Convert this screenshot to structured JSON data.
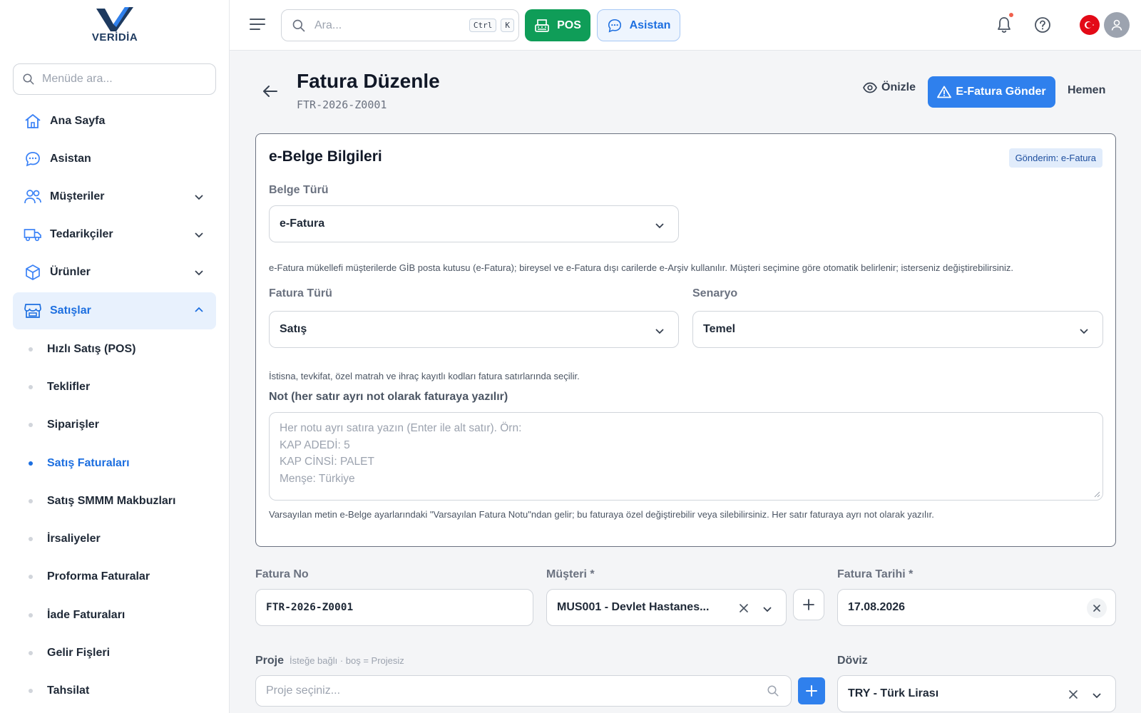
{
  "brand": {
    "logo_text": "VERİDİA"
  },
  "sidebar": {
    "search_placeholder": "Menüde ara...",
    "items": [
      {
        "label": "Ana Sayfa",
        "icon": "home-icon"
      },
      {
        "label": "Asistan",
        "icon": "chat-icon"
      },
      {
        "label": "Müşteriler",
        "icon": "users-icon",
        "expandable": true
      },
      {
        "label": "Tedarikçiler",
        "icon": "truck-icon",
        "expandable": true
      },
      {
        "label": "Ürünler",
        "icon": "box-icon",
        "expandable": true
      },
      {
        "label": "Satışlar",
        "icon": "store-icon",
        "expandable": true,
        "expanded": true,
        "active": true
      }
    ],
    "sub_items": [
      {
        "label": "Hızlı Satış (POS)"
      },
      {
        "label": "Teklifler"
      },
      {
        "label": "Siparişler"
      },
      {
        "label": "Satış Faturaları",
        "active": true
      },
      {
        "label": "Satış SMMM Makbuzları"
      },
      {
        "label": "İrsaliyeler"
      },
      {
        "label": "Proforma Faturalar"
      },
      {
        "label": "İade Faturaları"
      },
      {
        "label": "Gelir Fişleri"
      },
      {
        "label": "Tahsilat"
      }
    ]
  },
  "topbar": {
    "search_placeholder": "Ara...",
    "shortcut_keys": [
      "Ctrl",
      "K"
    ],
    "pos_label": "POS",
    "assistant_label": "Asistan"
  },
  "page": {
    "title": "Fatura Düzenle",
    "doc_number": "FTR-2026-Z0001",
    "preview_label": "Önizle",
    "send_label": "E-Fatura Gönder",
    "now_label": "Hemen"
  },
  "ebelge": {
    "title": "e-Belge Bilgileri",
    "badge": "Gönderim: e-Fatura",
    "doc_type_label": "Belge Türü",
    "doc_type_value": "e-Fatura",
    "doc_type_help": "e-Fatura mükellefi müşterilerde GİB posta kutusu (e-Fatura); bireysel ve e-Fatura dışı carilerde e-Arşiv kullanılır. Müşteri seçimine göre otomatik belirlenir; isterseniz değiştirebilirsiniz.",
    "invoice_type_label": "Fatura Türü",
    "invoice_type_value": "Satış",
    "scenario_label": "Senaryo",
    "scenario_value": "Temel",
    "codes_help": "İstisna, tevkifat, özel matrah ve ihraç kayıtlı kodları fatura satırlarında seçilir.",
    "note_label": "Not (her satır ayrı not olarak faturaya yazılır)",
    "note_placeholder_lines": [
      "Her notu ayrı satıra yazın (Enter ile alt satır). Örn:",
      "KAP ADEDİ: 5",
      "KAP CİNSİ: PALET",
      "Menşe: Türkiye"
    ],
    "note_help": "Varsayılan metin e-Belge ayarlarındaki \"Varsayılan Fatura Notu\"ndan gelir; bu faturaya özel değiştirebilir veya silebilirsiniz. Her satır faturaya ayrı not olarak yazılır."
  },
  "form": {
    "invoice_no_label": "Fatura No",
    "invoice_no_value": "FTR-2026-Z0001",
    "customer_label": "Müşteri *",
    "customer_value": "MUS001 - Devlet Hastanes...",
    "date_label": "Fatura Tarihi *",
    "date_value": "17.08.2026",
    "project_label": "Proje",
    "project_hint": "İsteğe bağlı · boş = Projesiz",
    "project_placeholder": "Proje seçiniz...",
    "currency_label": "Döviz",
    "currency_value": "TRY - Türk Lirası"
  },
  "colors": {
    "accent": "#2f80ed",
    "pos_green": "#0f9d58",
    "active_bg": "#e8f1fd",
    "notification": "#f0604d",
    "flag_red": "#e30a17"
  }
}
